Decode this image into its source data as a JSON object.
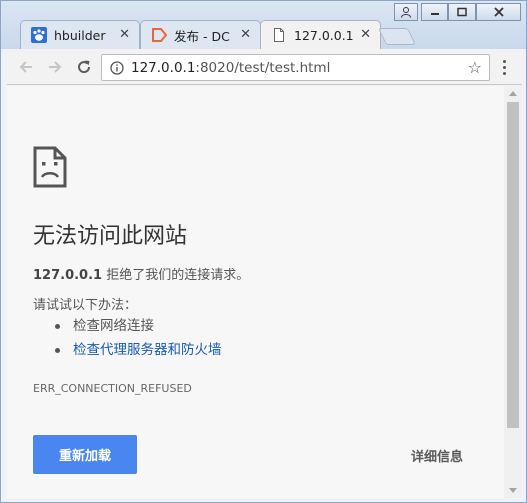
{
  "tabs": [
    {
      "title": "hbuilder",
      "icon": "baidu-paw-icon"
    },
    {
      "title": "发布 - DC",
      "icon": "dcloud-icon"
    },
    {
      "title": "127.0.0.1",
      "icon": "page-icon"
    }
  ],
  "omnibox": {
    "url_host": "127.0.0.1",
    "url_rest": ":8020/test/test.html"
  },
  "error_page": {
    "title": "无法访问此网站",
    "host": "127.0.0.1",
    "summary_rest": " 拒绝了我们的连接请求。",
    "try_label": "请试试以下办法：",
    "suggestions": [
      "检查网络连接",
      "检查代理服务器和防火墙"
    ],
    "error_code": "ERR_CONNECTION_REFUSED",
    "reload_label": "重新加载",
    "details_label": "详细信息"
  },
  "colors": {
    "accent": "#4a86f0",
    "link": "#1a5bb3"
  }
}
